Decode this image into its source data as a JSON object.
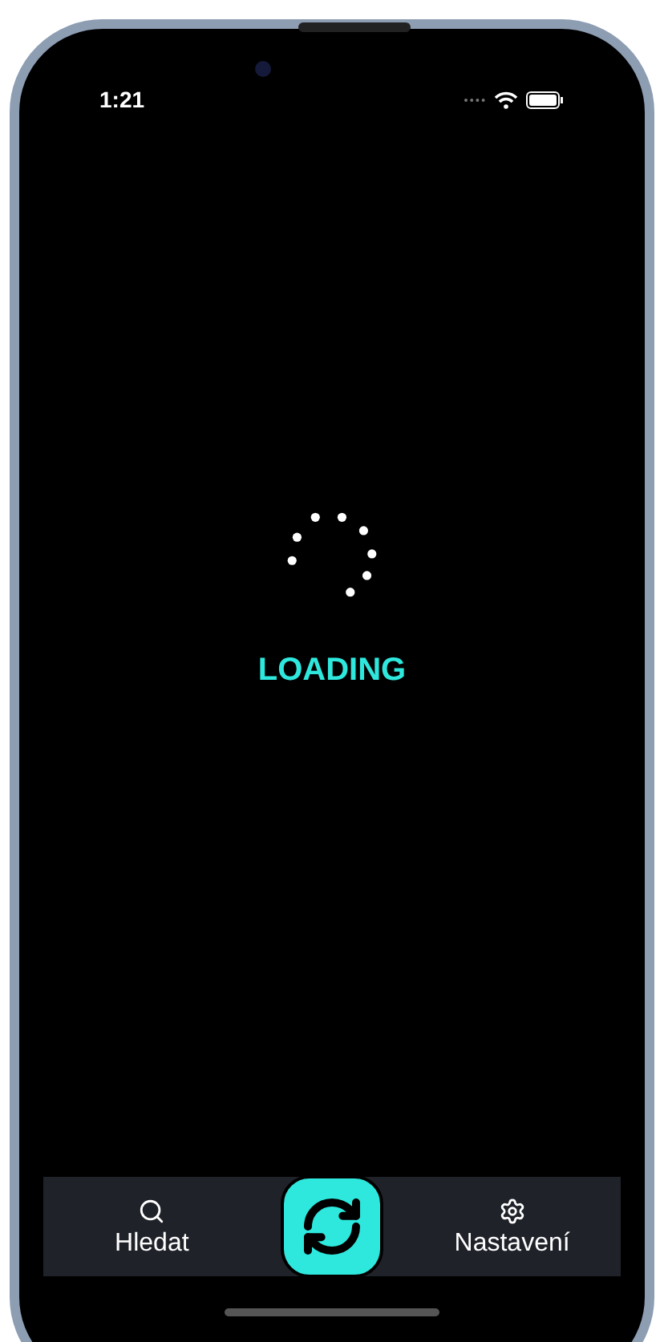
{
  "status_bar": {
    "time": "1:21"
  },
  "loading": {
    "label": "LOADING"
  },
  "tab_bar": {
    "items": [
      {
        "kind": "search",
        "label": "Hledat"
      },
      {
        "kind": "sync"
      },
      {
        "kind": "settings",
        "label": "Nastavení"
      }
    ]
  }
}
